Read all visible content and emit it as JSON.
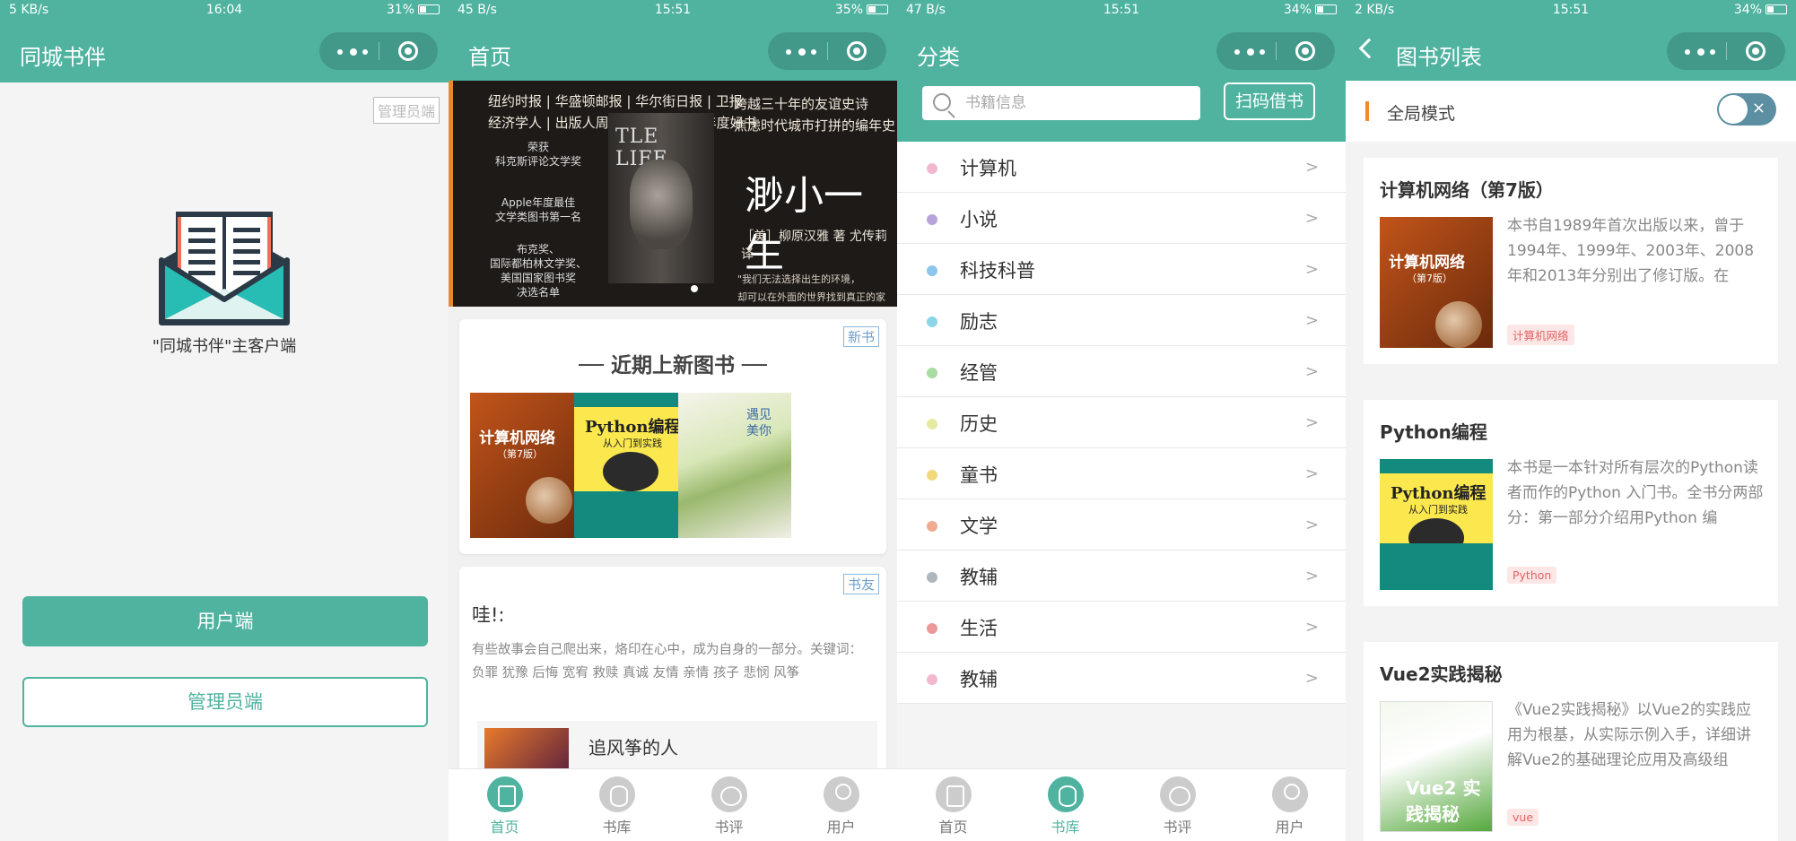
{
  "screens": [
    {
      "status": {
        "left": "5 KB/s",
        "time": "16:04",
        "battery": "31%"
      },
      "title": "同城书伴",
      "admin_tag": "管理员端",
      "app_name": "\"同城书伴\"主客户端",
      "btn_user": "用户端",
      "btn_admin": "管理员端"
    },
    {
      "status": {
        "left": "45 B/s",
        "time": "15:51",
        "battery": "35%"
      },
      "title": "首页",
      "banner": {
        "press_line1": "纽约时报 | 华盛顿邮报 | 华尔街日报 | 卫报",
        "press_line2": "经济学人 | 出版人周报等数十家媒体年度好书",
        "award1": "荣获\n科克斯评论文学奖",
        "award2": "Apple年度最佳\n文学类图书第一名",
        "award3": "布克奖、\n国际都柏林文学奖、\n美国国家图书奖\n决选名单",
        "cover_text": "TLE LIFE",
        "tagline": "跨越三十年的友谊史诗\n焦虑时代城市打拼的编年史",
        "big_title": "渺小一生",
        "author": "［美］柳原汉雅 著    尤传莉 译",
        "quote": "\"我们无法选择出生的环境，\n却可以在外面的世界找到真正的家人。\""
      },
      "new_tag": "新书",
      "new_title": "── 近期上新图书 ──",
      "covers": {
        "net_title": "计算机网络",
        "net_edition": "（第7版）",
        "py_title": "Python编程",
        "py_sub": "从入门到实践",
        "novel_title": "遇见美你"
      },
      "friend_tag": "书友",
      "friend_title": "哇!:",
      "friend_text": "有些故事会自己爬出来，烙印在心中，成为自身的一部分。关键词：负罪 犹豫 后悔 宽宥 救赎 真诚 友情 亲情 孩子 悲悯 风筝",
      "friend_book": "追风筝的人",
      "tabs": [
        "首页",
        "书库",
        "书评",
        "用户"
      ],
      "active_tab": 0
    },
    {
      "status": {
        "left": "47 B/s",
        "time": "15:51",
        "battery": "34%"
      },
      "title": "分类",
      "search_placeholder": "书籍信息",
      "scan_btn": "扫码借书",
      "categories": [
        {
          "name": "计算机",
          "color": "#f2b8cf"
        },
        {
          "name": "小说",
          "color": "#b9a3dd"
        },
        {
          "name": "科技科普",
          "color": "#8cc6ea"
        },
        {
          "name": "励志",
          "color": "#8ad6e6"
        },
        {
          "name": "经管",
          "color": "#a8dca0"
        },
        {
          "name": "历史",
          "color": "#e5eaa1"
        },
        {
          "name": "童书",
          "color": "#f3d97b"
        },
        {
          "name": "文学",
          "color": "#f0aa90"
        },
        {
          "name": "教辅",
          "color": "#aeb7bb"
        },
        {
          "name": "生活",
          "color": "#ec9898"
        },
        {
          "name": "教辅",
          "color": "#f2b8cf"
        }
      ],
      "arrow": ">",
      "tabs": [
        "首页",
        "书库",
        "书评",
        "用户"
      ],
      "active_tab": 1
    },
    {
      "status": {
        "left": "2 KB/s",
        "time": "15:51",
        "battery": "34%"
      },
      "title": "图书列表",
      "mode_label": "全局模式",
      "toggle_x": "×",
      "books": [
        {
          "title": "计算机网络（第7版）",
          "desc": "本书自1989年首次出版以来，曾于1994年、1999年、2003年、2008年和2013年分别出了修订版。在",
          "tag": "计算机网络"
        },
        {
          "title": "Python编程",
          "desc": "本书是一本针对所有层次的Python读者而作的Python 入门书。全书分两部分：第一部分介绍用Python 编",
          "tag": "Python"
        },
        {
          "title": "Vue2实践揭秘",
          "desc": "《Vue2实践揭秘》以Vue2的实践应用为根基，从实际示例入手，详细讲解Vue2的基础理论应用及高级组",
          "tag": "vue",
          "cover": "Vue2 实践揭秘"
        }
      ]
    }
  ],
  "colors": {
    "primary": "#4fb3a0",
    "accent_orange": "#f08a2c",
    "tag_red": "#e06464"
  }
}
